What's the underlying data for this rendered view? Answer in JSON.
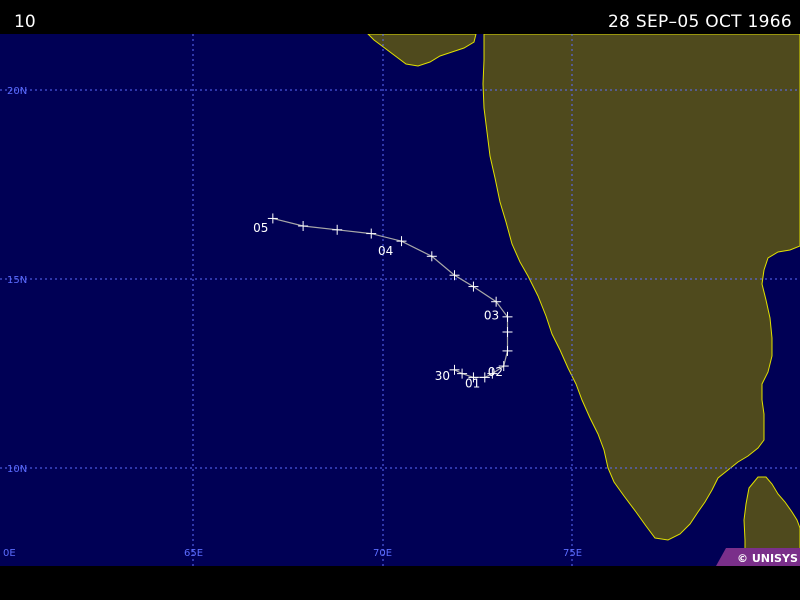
{
  "header": {
    "storm_number": "10",
    "date_range": "28 SEP–05 OCT 1966"
  },
  "map": {
    "ocean_color": "#000055",
    "land_color": "#4f4a1d",
    "coast_color": "#e0e000",
    "grid_color": "#5b6cff",
    "track_color": "#a8a8a8",
    "lon_range": [
      60,
      81
    ],
    "lat_range": [
      8,
      22
    ],
    "latitude_labels": [
      {
        "lat": 20,
        "text": "20N"
      },
      {
        "lat": 15,
        "text": "15N"
      },
      {
        "lat": 10,
        "text": "10N"
      }
    ],
    "longitude_labels": [
      {
        "lon": 60,
        "text": "0E"
      },
      {
        "lon": 65,
        "text": "65E"
      },
      {
        "lon": 70,
        "text": "70E"
      },
      {
        "lon": 75,
        "text": "75E"
      }
    ],
    "credit": "© UNISYS"
  },
  "track": {
    "points": [
      {
        "lon": 71.9,
        "lat": 12.6
      },
      {
        "lon": 72.1,
        "lat": 12.5
      },
      {
        "lon": 72.4,
        "lat": 12.4
      },
      {
        "lon": 72.7,
        "lat": 12.4
      },
      {
        "lon": 72.9,
        "lat": 12.5
      },
      {
        "lon": 73.2,
        "lat": 12.7
      },
      {
        "lon": 73.3,
        "lat": 13.1
      },
      {
        "lon": 73.3,
        "lat": 13.6
      },
      {
        "lon": 73.3,
        "lat": 14.0
      },
      {
        "lon": 73.0,
        "lat": 14.4
      },
      {
        "lon": 72.4,
        "lat": 14.8
      },
      {
        "lon": 71.9,
        "lat": 15.1
      },
      {
        "lon": 71.3,
        "lat": 15.6
      },
      {
        "lon": 70.5,
        "lat": 16.0
      },
      {
        "lon": 69.7,
        "lat": 16.2
      },
      {
        "lon": 68.8,
        "lat": 16.3
      },
      {
        "lon": 67.9,
        "lat": 16.4
      },
      {
        "lon": 67.1,
        "lat": 16.6
      }
    ],
    "day_labels": [
      {
        "text": "30",
        "lon": 71.8,
        "lat": 12.6
      },
      {
        "text": "01",
        "lon": 72.6,
        "lat": 12.4
      },
      {
        "text": "02",
        "lon": 73.2,
        "lat": 12.7
      },
      {
        "text": "03",
        "lon": 73.1,
        "lat": 14.2
      },
      {
        "text": "04",
        "lon": 70.3,
        "lat": 15.9
      },
      {
        "text": "05",
        "lon": 67.0,
        "lat": 16.5
      }
    ]
  }
}
